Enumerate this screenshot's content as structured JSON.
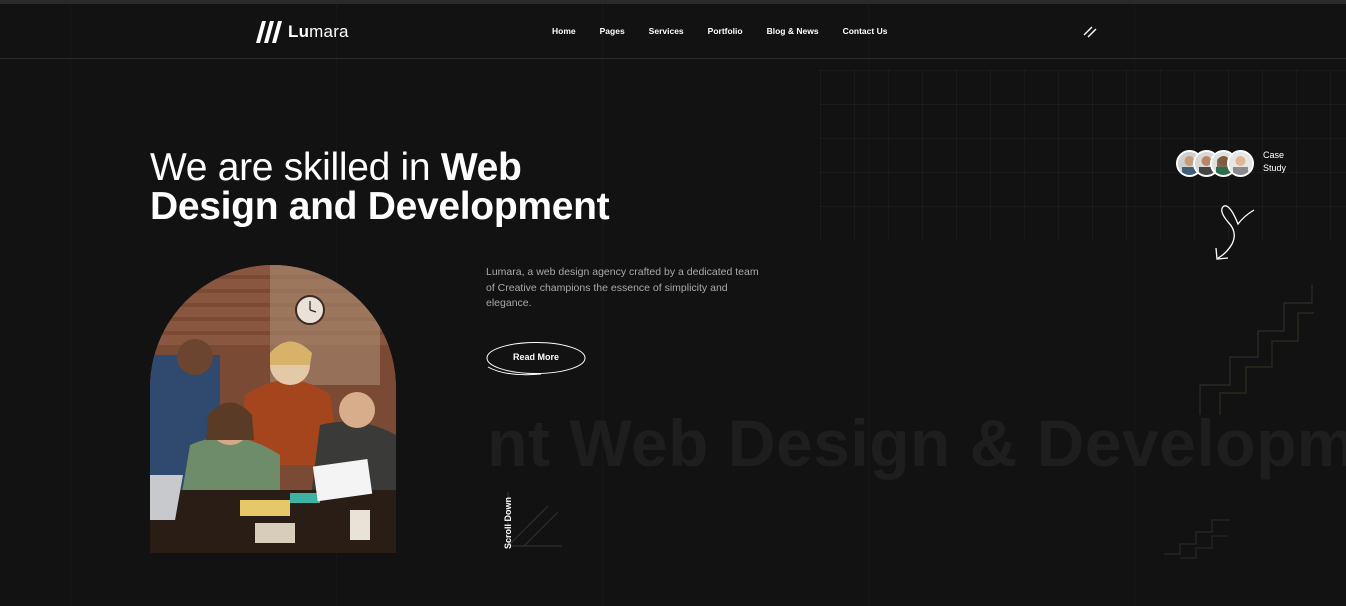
{
  "brand": {
    "name_bold": "Lu",
    "name_light": "mara"
  },
  "nav": {
    "items": [
      {
        "label": "Home"
      },
      {
        "label": "Pages"
      },
      {
        "label": "Services"
      },
      {
        "label": "Portfolio"
      },
      {
        "label": "Blog & News"
      },
      {
        "label": "Contact Us"
      }
    ]
  },
  "hero": {
    "headline_regular": "We are skilled in ",
    "headline_bold_1": "Web",
    "headline_bold_2": "Design and Development",
    "description": "Lumara, a web design agency crafted by a dedicated team of Creative champions the essence of simplicity and elegance.",
    "read_more_label": "Read More",
    "marquee_text": "ent  Web Design & Development",
    "scroll_down_label": "Scroll Down"
  },
  "case_study": {
    "line1": "Case",
    "line2": "Study"
  },
  "icons": {
    "logo": "logo-slashes-icon",
    "menu": "menu-toggle-icon",
    "arrow": "curly-arrow-icon",
    "scroll": "diagonal-arrow-icon"
  },
  "colors": {
    "background": "#121212",
    "text": "#ffffff",
    "muted": "#a9a9a9",
    "marquee": "#1e1e1e"
  }
}
